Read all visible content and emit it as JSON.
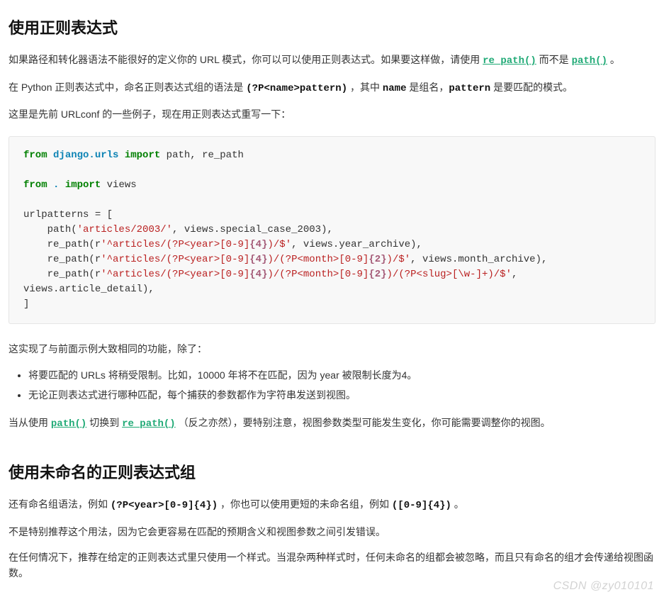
{
  "h1": "使用正则表达式",
  "p1_a": "如果路径和转化器语法不能很好的定义你的 URL 模式，你可以可以使用正则表达式。如果要这样做，请使用 ",
  "p1_link1": "re_path()",
  "p1_b": " 而不是 ",
  "p1_link2": "path()",
  "p1_c": " 。",
  "p2_a": "在 Python 正则表达式中，命名正则表达式组的语法是 ",
  "p2_code": "(?P<name>pattern)",
  "p2_b": " ，其中 ",
  "p2_name": "name",
  "p2_c": " 是组名，",
  "p2_pattern": "pattern",
  "p2_d": " 是要匹配的模式。",
  "p3": "这里是先前 URLconf 的一些例子，现在用正则表达式重写一下：",
  "code": {
    "l1_from": "from",
    "l1_mod": "django.urls",
    "l1_import": "import",
    "l1_rest": " path, re_path",
    "l2_from": "from",
    "l2_mod": ".",
    "l2_import": "import",
    "l2_rest": " views",
    "l3": "urlpatterns = [",
    "l4_a": "    path(",
    "l4_str": "'articles/2003/'",
    "l4_b": ", views.special_case_2003),",
    "l5_a": "    re_path(r",
    "l5_s1": "'^articles/(?P<year>[0-9]",
    "l5_e1": "{4}",
    "l5_s2": ")/$'",
    "l5_b": ", views.year_archive),",
    "l6_a": "    re_path(r",
    "l6_s1": "'^articles/(?P<year>[0-9]",
    "l6_e1": "{4}",
    "l6_s2": ")/(?P<month>[0-9]",
    "l6_e2": "{2}",
    "l6_s3": ")/$'",
    "l6_b": ", views.month_archive),",
    "l7_a": "    re_path(r",
    "l7_s1": "'^articles/(?P<year>[0-9]",
    "l7_e1": "{4}",
    "l7_s2": ")/(?P<month>[0-9]",
    "l7_e2": "{2}",
    "l7_s3": ")/(?P<slug>[\\w-]+)/$'",
    "l7_b": ", views.article_detail),",
    "l8": "]"
  },
  "p4": "这实现了与前面示例大致相同的功能，除了：",
  "li1": "将要匹配的 URLs 将稍受限制。比如，10000 年将不在匹配，因为 year 被限制长度为4。",
  "li2": "无论正则表达式进行哪种匹配，每个捕获的参数都作为字符串发送到视图。",
  "p5_a": "当从使用 ",
  "p5_link1": "path()",
  "p5_b": " 切换到 ",
  "p5_link2": "re_path()",
  "p5_c": " （反之亦然），要特别注意，视图参数类型可能发生变化，你可能需要调整你的视图。",
  "h2": "使用未命名的正则表达式组",
  "p6_a": "还有命名组语法，例如 ",
  "p6_code1": "(?P<year>[0-9]{4})",
  "p6_b": " ，你也可以使用更短的未命名组，例如 ",
  "p6_code2": "([0-9]{4})",
  "p6_c": " 。",
  "p7": "不是特别推荐这个用法，因为它会更容易在匹配的预期含义和视图参数之间引发错误。",
  "p8": "在任何情况下，推荐在给定的正则表达式里只使用一个样式。当混杂两种样式时，任何未命名的组都会被忽略，而且只有命名的组才会传递给视图函数。",
  "watermark": "CSDN @zy010101"
}
